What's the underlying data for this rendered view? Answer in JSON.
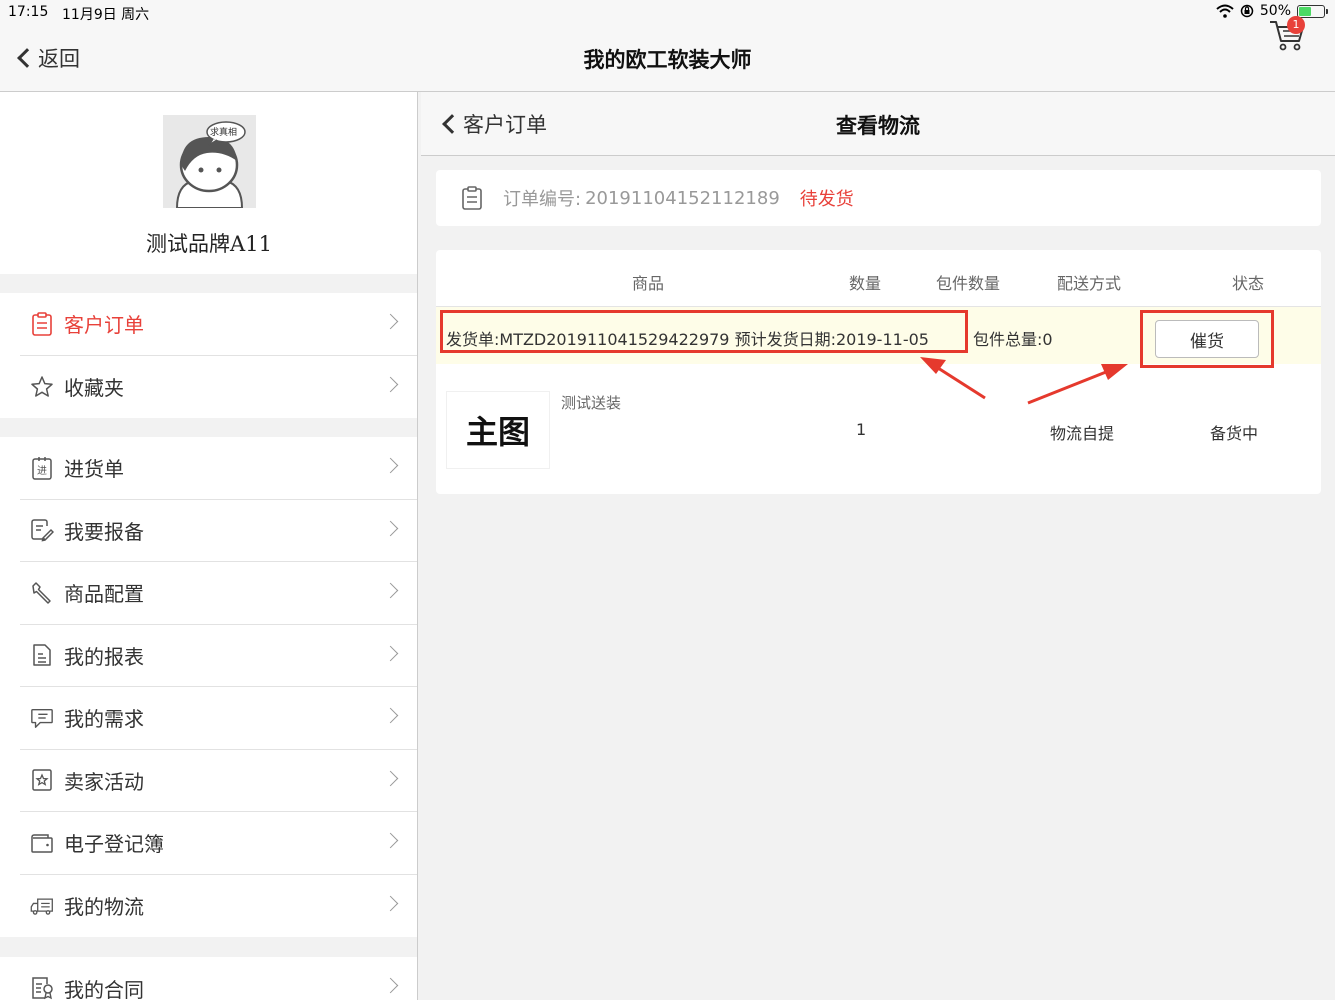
{
  "status_bar": {
    "time": "17:15",
    "date": "11月9日 周六",
    "battery": "50%",
    "battery_level": 0.5
  },
  "navbar": {
    "back_label": "返回",
    "title": "我的欧工软装大师",
    "cart_badge": "1"
  },
  "profile": {
    "avatar_caption": "求真相",
    "brand_name": "测试品牌A11"
  },
  "menu": {
    "group1": [
      {
        "label": "客户订单",
        "icon": "clipboard-icon",
        "active": true
      },
      {
        "label": "收藏夹",
        "icon": "star-icon",
        "active": false
      }
    ],
    "group2": [
      {
        "label": "进货单",
        "icon": "purchase-order-icon"
      },
      {
        "label": "我要报备",
        "icon": "report-edit-icon"
      },
      {
        "label": "商品配置",
        "icon": "wrench-icon"
      },
      {
        "label": "我的报表",
        "icon": "document-icon"
      },
      {
        "label": "我的需求",
        "icon": "chat-icon"
      },
      {
        "label": "卖家活动",
        "icon": "badge-star-icon"
      },
      {
        "label": "电子登记簿",
        "icon": "wallet-icon"
      },
      {
        "label": "我的物流",
        "icon": "truck-icon"
      }
    ],
    "group3": [
      {
        "label": "我的合同",
        "icon": "contract-icon"
      }
    ],
    "group2_icon_text": "进"
  },
  "subnav": {
    "back_label": "客户订单",
    "title": "查看物流"
  },
  "order": {
    "number_label": "订单编号:",
    "number": "20191104152112189",
    "status": "待发货"
  },
  "table": {
    "headers": [
      "商品",
      "数量",
      "包件数量",
      "配送方式",
      "状态"
    ],
    "shipment": {
      "text": "发货单:MTZD201911041529422979 预计发货日期:2019-11-05",
      "total": "包件总量:0",
      "urge_button": "催货"
    },
    "row": {
      "image_placeholder": "主图",
      "name": "测试送装",
      "quantity": "1",
      "package_count": "",
      "delivery": "物流自提",
      "status": "备货中"
    }
  },
  "colors": {
    "accent": "#e8413a",
    "annotation": "#e5392d",
    "highlight_row": "#fefde8"
  }
}
